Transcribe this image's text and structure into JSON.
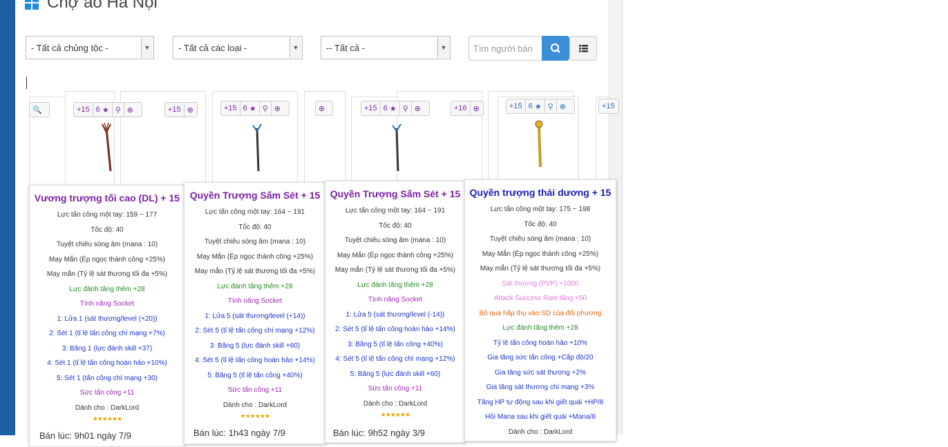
{
  "page": {
    "title": "Chợ ảo Hà Nội",
    "colors": {
      "accent": "#3a8fd6",
      "item_name_purple": "#7b1fa2",
      "item_name_blue": "#1a1ab0"
    }
  },
  "filters": {
    "race": "- Tất cả chủng tộc -",
    "type": "- Tất cả các loại -",
    "all": "-- Tất cả -",
    "seller_placeholder": "Tìm người bán"
  },
  "badges": {
    "plus": "+15",
    "sockets": "6",
    "partial_plus": "+16",
    "b1": "+15"
  },
  "tooltips": [
    {
      "name": "Vương trượng tối cao (DL) + 15",
      "lines": [
        "Lực tấn công một tay: 159 ~ 177",
        "Tốc độ: 40",
        "Tuyệt chiêu sóng âm (mana : 10)",
        "May Mắn (Ép ngọc thành công +25%)",
        "May mắn (Tỷ lệ sát thương tối đa +5%)",
        "Lực đánh tăng thêm +28",
        "Tính năng Socket",
        "1: Lửa 1 (sát thương/level (+20))",
        "2: Sét 1 (tỉ lệ tấn công chí mạng +7%)",
        "3: Băng 1 (lực đánh skill +37)",
        "4: Sét 1 (tỉ lệ tấn công hoàn hảo +10%)",
        "5: Sét 1 (tấn công chí mạng +30)",
        "Sức tấn công +11",
        "Dành cho : DarkLord"
      ],
      "stars": "★★★★★★",
      "sold": "Bán lúc: 9h01 ngày 7/9"
    },
    {
      "name": "Quyền Trượng Sấm Sét + 15",
      "lines": [
        "Lực tấn công một tay: 164 ~ 191",
        "Tốc độ: 40",
        "Tuyệt chiêu sóng âm (mana : 10)",
        "May Mắn (Ép ngọc thành công +25%)",
        "May mắn (Tỷ lệ sát thương tối đa +5%)",
        "Lực đánh tăng thêm +28",
        "Tính năng Socket",
        "1: Lửa 5 (sát thương/level (+14))",
        "2: Sét 5 (tỉ lệ tấn công chí mạng +12%)",
        "3: Băng 5 (lực đánh skill +60)",
        "4: Sét 5 (tỉ lệ tấn công hoàn hảo +14%)",
        "5: Băng 5 (tỉ lệ tấn công +40%)",
        "Sức tấn công +11",
        "Dành cho : DarkLord"
      ],
      "stars": "★★★★★★",
      "sold": "Bán lúc: 1h43 ngày 7/9"
    },
    {
      "name": "Quyền Trượng Sấm Sét + 15",
      "lines": [
        "Lực tấn công một tay: 164 ~ 191",
        "Tốc độ: 40",
        "Tuyệt chiêu sóng âm (mana : 10)",
        "May Mắn (Ép ngọc thành công +25%)",
        "May mắn (Tỷ lệ sát thương tối đa +5%)",
        "Lực đánh tăng thêm +28",
        "Tính năng Socket",
        "1: Lửa 5 (sát thương/level (-14))",
        "2: Sét 5 (tỉ lệ tấn công hoàn hảo +14%)",
        "3: Băng 5 (tỉ lệ tấn công +40%)",
        "4: Sét 5 (tỉ lệ tấn công chí mạng +12%)",
        "5: Băng 5 (lực đánh skill +60)",
        "Sức tấn công +11",
        "Dành cho : DarkLord"
      ],
      "stars": "★★★★★★",
      "sold": "Bán lúc: 9h52 ngày 3/9"
    },
    {
      "name": "Quyền trượng thái dương + 15",
      "lines": [
        "Lực tấn công một tay: 175 ~ 198",
        "Tốc độ: 40",
        "Tuyệt chiêu sóng âm (mana : 10)",
        "May Mắn (Ép ngọc thành công +25%)",
        "May mắn (Tỷ lệ sát thương tối đa +5%)",
        "Sát thương (PVP) +1000",
        "Attack Success Rate tăng +50",
        "Bỏ qua hấp thụ vào SD của đối phương",
        "Lực đánh tăng thêm +28",
        "Tỷ lệ tấn công hoàn hảo +10%",
        "Gia tăng sức tấn công +Cấp độ/20",
        "Gia tăng sức sát thương +2%",
        "Gia tăng sát thương chí mạng +3%",
        "Tăng HP tự động sau khi giết quái +HP/8",
        "Hồi Mana sau khi giết quái +Mana/8",
        "Dành cho : DarkLord"
      ]
    }
  ]
}
